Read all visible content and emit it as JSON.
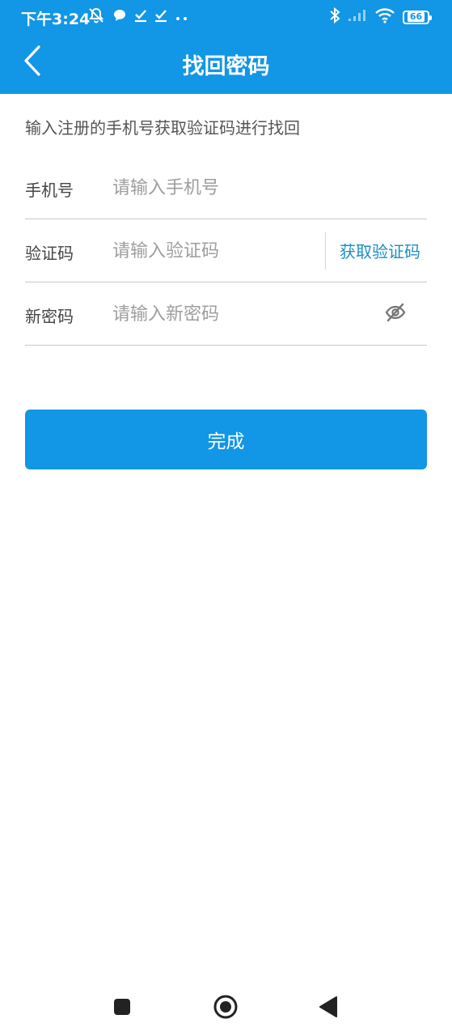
{
  "status_bar": {
    "time": "下午3:24",
    "battery": "66",
    "left_icons": [
      "mute-bell-icon",
      "chat-bubble-icon",
      "check-icon",
      "check-icon",
      "more-dots-icon"
    ],
    "right_icons": [
      "bluetooth-icon",
      "signal-icon",
      "wifi-icon",
      "battery-icon"
    ]
  },
  "app_bar": {
    "title": "找回密码",
    "back_icon": "chevron-left-icon"
  },
  "form": {
    "hint": "输入注册的手机号获取验证码进行找回",
    "phone": {
      "label": "手机号",
      "placeholder": "请输入手机号",
      "value": ""
    },
    "code": {
      "label": "验证码",
      "placeholder": "请输入验证码",
      "value": "",
      "action_label": "获取验证码"
    },
    "password": {
      "label": "新密码",
      "placeholder": "请输入新密码",
      "value": "",
      "toggle_icon": "eye-off-icon"
    }
  },
  "submit": {
    "label": "完成"
  },
  "nav_bar": {
    "icons": [
      "recent-apps-icon",
      "home-icon",
      "back-triangle-icon"
    ]
  },
  "colors": {
    "primary": "#1296e6",
    "link": "#1b8fc2",
    "divider": "#c8c8c8"
  }
}
